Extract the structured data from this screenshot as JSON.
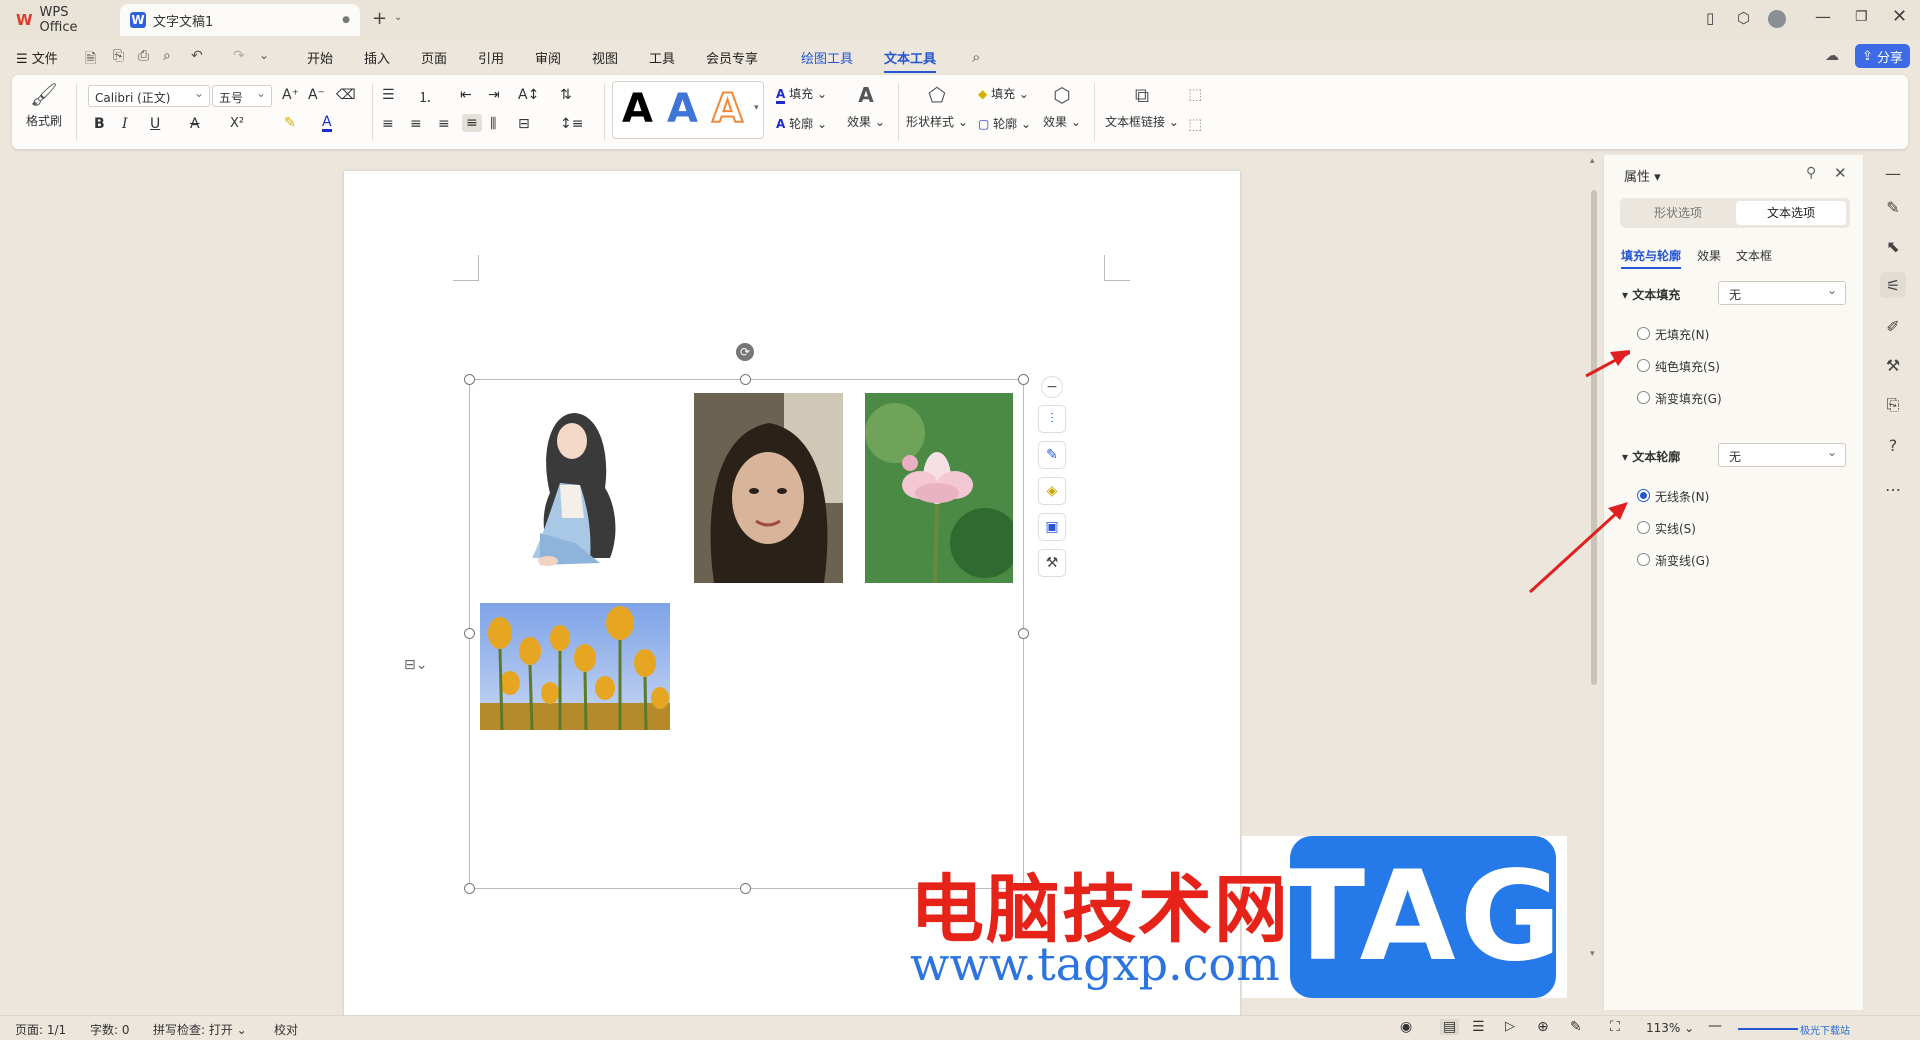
{
  "titlebar": {
    "app_tab": "WPS Office",
    "doc_tab": "文字文稿1"
  },
  "menubar": {
    "file": "文件",
    "items": [
      "开始",
      "插入",
      "页面",
      "引用",
      "审阅",
      "视图",
      "工具",
      "会员专享",
      "绘图工具",
      "文本工具"
    ],
    "share": "分享"
  },
  "ribbon": {
    "format_painter": "格式刷",
    "font_name": "Calibri (正文)",
    "font_size": "五号",
    "fill": "填充",
    "outline": "轮廓",
    "effect": "效果",
    "shape_style": "形状样式",
    "shape_fill": "填充",
    "shape_outline": "轮廓",
    "shape_effect": "效果",
    "textbox_link": "文本框链接",
    "art_sample": "A"
  },
  "pane": {
    "title": "属性",
    "tabs": [
      "形状选项",
      "文本选项"
    ],
    "subtabs": [
      "填充与轮廓",
      "效果",
      "文本框"
    ],
    "fill_section": "文本填充",
    "fill_value": "无",
    "fill_options": [
      "无填充(N)",
      "纯色填充(S)",
      "渐变填充(G)"
    ],
    "outline_section": "文本轮廓",
    "outline_value": "无",
    "outline_options": [
      "无线条(N)",
      "实线(S)",
      "渐变线(G)"
    ],
    "selected_outline": "无线条(N)"
  },
  "status": {
    "page": "页面: 1/1",
    "words": "字数: 0",
    "spell": "拼写检查: 打开",
    "proof": "校对",
    "zoom": "113%"
  },
  "watermark": {
    "site_cn": "电脑技术网",
    "url": "www.tagxp.com",
    "tag": "TAG",
    "corner": "极光下载站"
  },
  "colors": {
    "accent": "#2556d4",
    "share_bg": "#3d6be6",
    "arrow": "#e02020",
    "watermark_red": "#e52318",
    "watermark_blue": "#2679e8"
  }
}
